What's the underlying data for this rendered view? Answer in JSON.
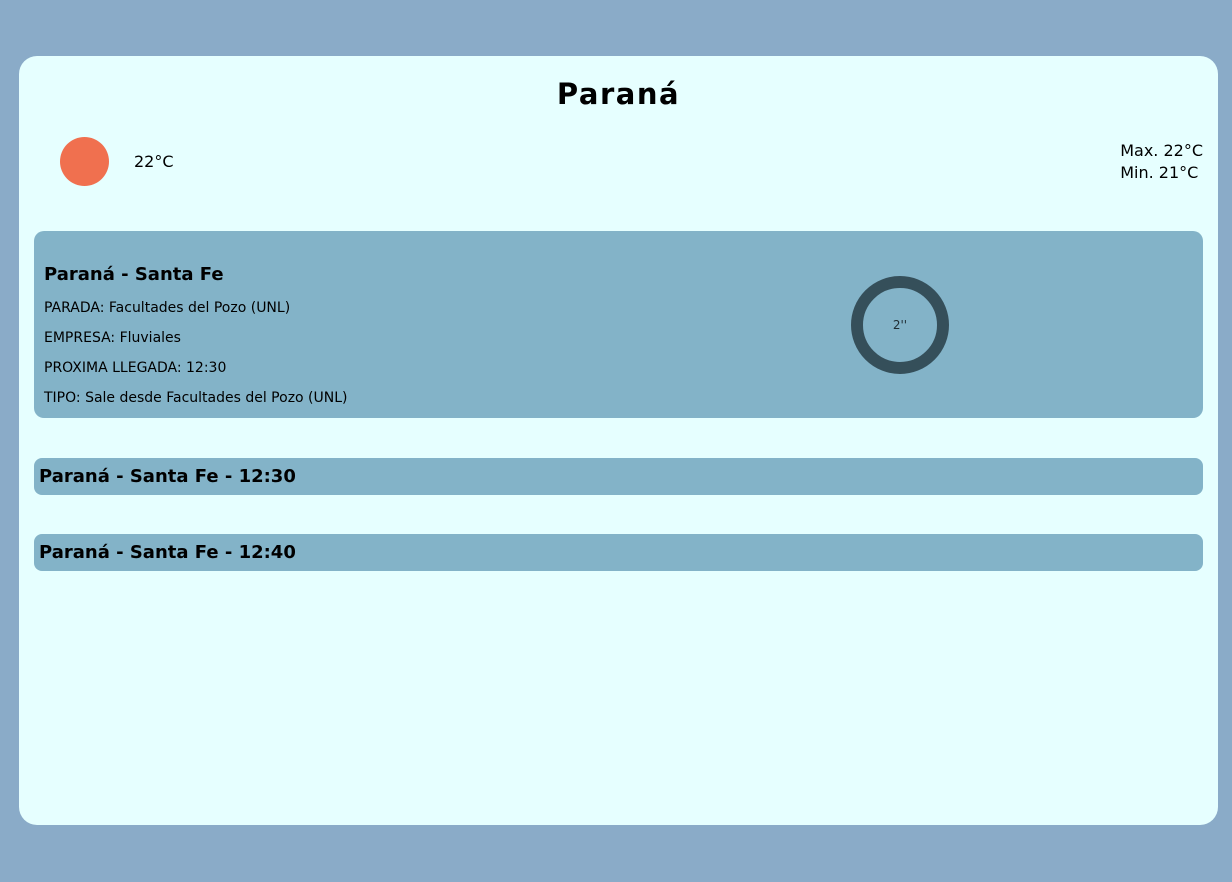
{
  "city": "Paraná",
  "weather": {
    "icon": "sun-icon",
    "icon_color": "#f0704f",
    "current_temp": "22°C",
    "max": "Max. 22°C",
    "min": "Min. 21°C"
  },
  "next_arrival": {
    "route": "Paraná - Santa Fe",
    "stop": "PARADA: Facultades del Pozo (UNL)",
    "company": "EMPRESA: Fluviales",
    "next": "PROXIMA LLEGADA: 12:30",
    "type": "TIPO: Sale desde Facultades del Pozo (UNL)",
    "countdown": "2''"
  },
  "schedule": [
    {
      "label": "Paraná - Santa Fe - 12:30"
    },
    {
      "label": "Paraná - Santa Fe - 12:40"
    }
  ],
  "colors": {
    "page_bg": "#8aabc8",
    "card_bg": "#e6ffff",
    "panel_bg": "#83b3c8",
    "ring": "#354f5a"
  }
}
